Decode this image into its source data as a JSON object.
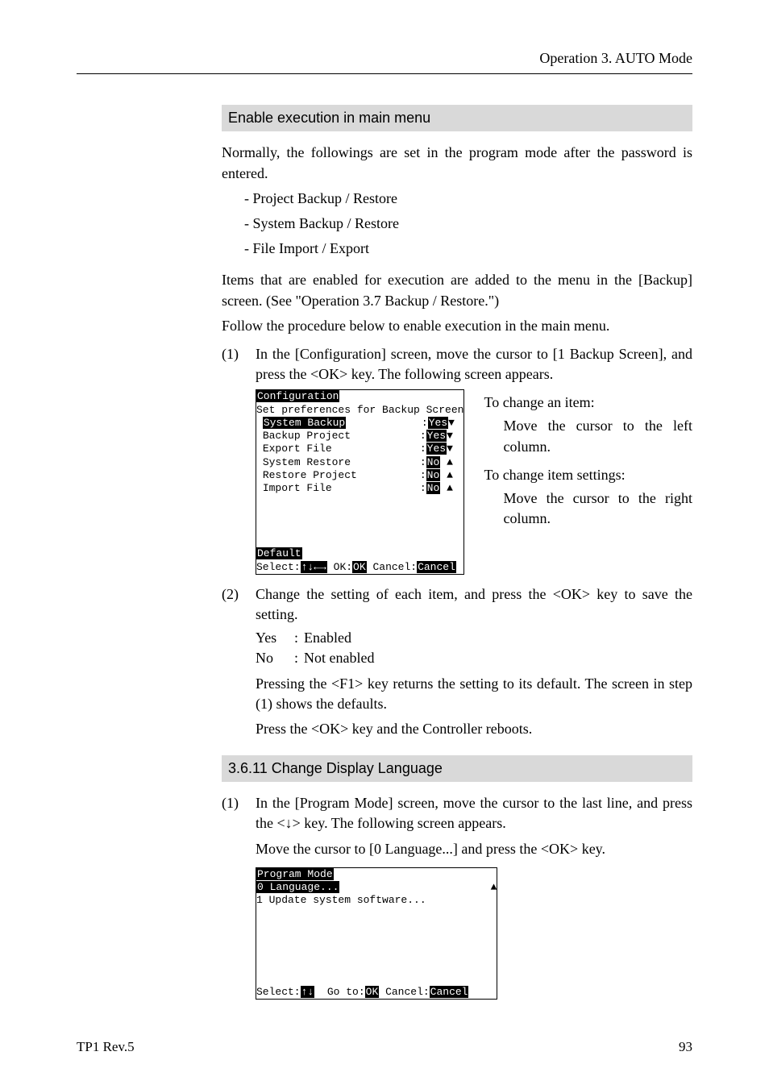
{
  "header": {
    "right": "Operation   3. AUTO Mode"
  },
  "section1": {
    "title": "Enable execution in main menu",
    "intro": "Normally, the followings are set in the program mode after the password is entered.",
    "bullets": [
      "- Project Backup / Restore",
      "- System Backup / Restore",
      "- File Import / Export"
    ],
    "p2": "Items that are enabled for execution are added to the menu in the [Backup] screen. (See \"Operation 3.7 Backup / Restore.\")",
    "p3": "Follow the procedure below to enable execution in the main menu.",
    "step1_num": "(1)",
    "step1": "In the [Configuration] screen, move the cursor to [1 Backup Screen], and press the <OK> key.    The following screen appears.",
    "screen1": {
      "title": "Configuration",
      "subtitle": "Set preferences for Backup Screen",
      "items": [
        {
          "label": "System Backup",
          "value": "Yes",
          "arrow": "▼",
          "sel": true
        },
        {
          "label": "Backup Project",
          "value": "Yes",
          "arrow": "▼",
          "sel": false
        },
        {
          "label": "Export File",
          "value": "Yes",
          "arrow": "▼",
          "sel": false
        },
        {
          "label": "System Restore",
          "value": "No",
          "arrow": "▲",
          "sel": false
        },
        {
          "label": "Restore Project",
          "value": "No",
          "arrow": "▲",
          "sel": false
        },
        {
          "label": "Import File",
          "value": "No",
          "arrow": "▲",
          "sel": false
        }
      ],
      "default_label": "Default",
      "footer": {
        "select": "Select:",
        "arrows": "↑↓←→",
        "ok_lbl": "OK:",
        "ok": "OK",
        "cancel_lbl": "Cancel:",
        "cancel": "Cancel"
      }
    },
    "sidenotes": {
      "a": "To change an item:",
      "a_sub": "Move the cursor to the left column.",
      "b": "To change item settings:",
      "b_sub": "Move the cursor to the right column."
    },
    "step2_num": "(2)",
    "step2": "Change the setting of each item, and press the <OK> key to save the setting.",
    "yesno": [
      {
        "k": "Yes",
        "c": ":",
        "v": "Enabled"
      },
      {
        "k": "No",
        "c": ":",
        "v": "Not enabled"
      }
    ],
    "step2_p2": "Pressing the <F1> key returns the setting to its default.    The screen in step (1) shows the defaults.",
    "step2_p3": "Press the <OK> key and the Controller reboots."
  },
  "section2": {
    "title": "3.6.11   Change Display Language",
    "step1_num": "(1)",
    "step1": "In the [Program Mode] screen, move the cursor to the last line, and press the <↓> key. The following screen appears.",
    "step1_p2": "Move the cursor to [0 Language...] and press the <OK> key.",
    "screen2": {
      "title": "Program Mode",
      "line0_text": "0 Language...",
      "line1_text": "1 Update system software...",
      "scroll": "▲",
      "footer": {
        "select": "Select:",
        "arrows": "↑↓",
        "goto_lbl": "Go to:",
        "ok": "OK",
        "cancel_lbl": "Cancel:",
        "cancel": "Cancel"
      }
    }
  },
  "footer": {
    "left": "TP1   Rev.5",
    "right": "93"
  }
}
